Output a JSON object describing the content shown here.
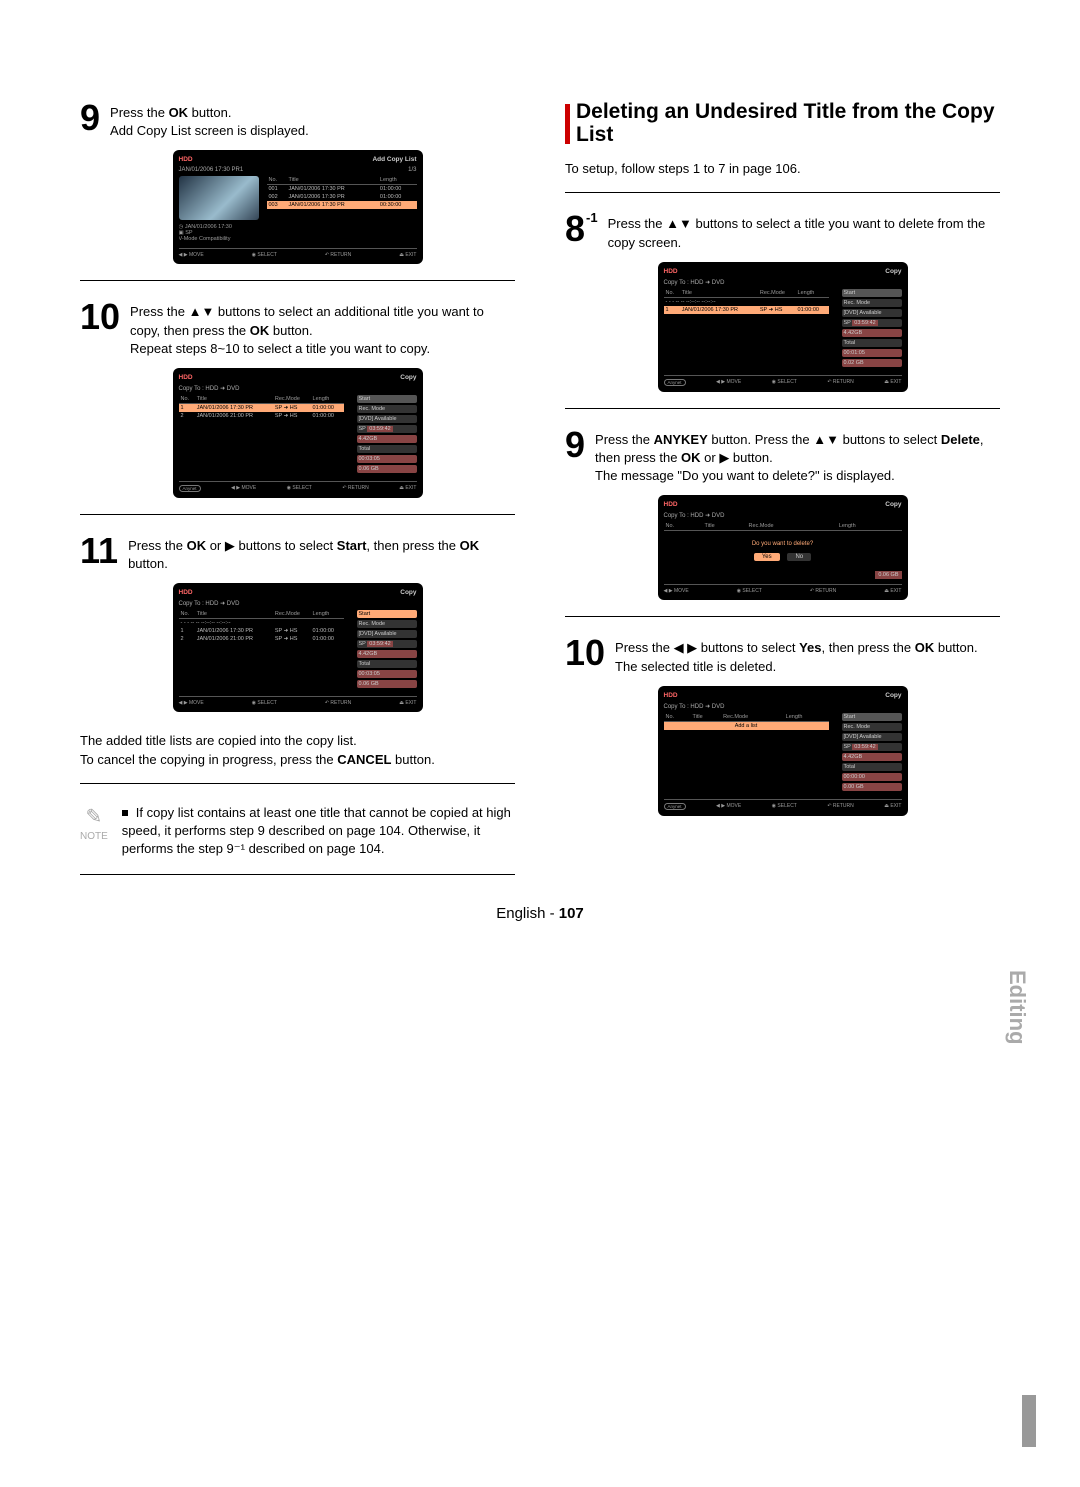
{
  "side_label": "Editing",
  "footer": {
    "lang": "English -",
    "page": "107"
  },
  "section": {
    "title": "Deleting an Undesired Title from the Copy List",
    "subtitle": "To setup, follow steps 1 to 7 in page 106."
  },
  "left": {
    "step9": {
      "num": "9",
      "l1a": "Press the ",
      "l1b": "OK",
      "l1c": " button.",
      "l2": "Add Copy List screen is displayed."
    },
    "step10": {
      "num": "10",
      "l1": "Press the ▲▼ buttons to select an additional title you want to copy, then press the ",
      "l1b": "OK",
      "l1c": " button.",
      "l2": "Repeat steps 8~10 to select a title you want to copy."
    },
    "step11": {
      "num": "11",
      "l1a": "Press the ",
      "l1b": "OK",
      "l1c": " or ▶ buttons to select ",
      "l1d": "Start",
      "l1e": ", then press the ",
      "l1f": "OK",
      "l1g": " button."
    },
    "post11": {
      "l1": "The added title lists are copied into the copy list.",
      "l2a": "To cancel the copying in progress, press the ",
      "l2b": "CANCEL",
      "l2c": " button."
    },
    "note": {
      "label": "NOTE",
      "text": "If copy list contains at least one title that cannot be copied at high speed, it performs step 9 described on page 104. Otherwise, it performs the step 9⁻¹ described on page 104."
    }
  },
  "right": {
    "step8": {
      "num": "8",
      "sup": "-1",
      "l1": "Press the ▲▼ buttons to select a title you want to delete from the copy screen."
    },
    "step9": {
      "num": "9",
      "l1a": "Press the ",
      "l1b": "ANYKEY",
      "l1c": " button. Press the ▲▼ buttons to select ",
      "l1d": "Delete",
      "l1e": ", then press the ",
      "l1f": "OK",
      "l1g": " or ▶ button.",
      "l2": "The message \"Do you want to delete?\" is displayed."
    },
    "step10": {
      "num": "10",
      "l1a": "Press the ◀ ▶ buttons to select ",
      "l1b": "Yes",
      "l1c": ", then press the ",
      "l1d": "OK",
      "l1e": " button.",
      "l2": "The selected title is deleted."
    }
  },
  "ui": {
    "hdd": "HDD",
    "addcopy_title": "Add Copy List",
    "copy_title": "Copy",
    "copyto": "Copy To : HDD ➜ DVD",
    "main_header": "JAN/01/2006 17:30 PR1",
    "main_counter": "1/3",
    "cols": {
      "no": "No.",
      "title": "Title",
      "rec": "Rec.Mode",
      "len": "Length"
    },
    "addlist_cols": {
      "no": "No.",
      "title": "Title",
      "len": "Length"
    },
    "addlist_rows": [
      {
        "no": "001",
        "title": "JAN/01/2006 17:30 PR",
        "len": "01:00:00"
      },
      {
        "no": "002",
        "title": "JAN/01/2006 17:30 PR",
        "len": "01:00:00"
      },
      {
        "no": "003",
        "title": "JAN/01/2006 17:30 PR",
        "hi": true,
        "len": "00:30:00"
      }
    ],
    "rows1": [
      {
        "no": "1",
        "title": "JAN/01/2006 17:30 PR",
        "rec": "SP ➜ HS",
        "len": "01:00:00",
        "hi": true
      },
      {
        "no": "2",
        "title": "JAN/01/2006 21:00 PR",
        "rec": "SP ➜ HS",
        "len": "01:00:00"
      }
    ],
    "rows2": [
      {
        "no": "1",
        "title": "JAN/01/2006 17:30 PR",
        "rec": "SP ➜ HS",
        "len": "01:00:00"
      },
      {
        "no": "2",
        "title": "JAN/01/2006 21:00 PR",
        "rec": "SP ➜ HS",
        "len": "01:00:00"
      }
    ],
    "rows_r1": [
      {
        "no": "1",
        "title": "JAN/01/2006 17:30 PR",
        "rec": "SP ➜ HS",
        "len": "01:00:00",
        "hi": true
      }
    ],
    "dashrow": "- - - -- -- --:--:-- --:--:--",
    "side": {
      "start": "Start",
      "recmode": "Rec. Mode",
      "avail": "[DVD] Available",
      "sp": "SP",
      "sp_t1": "03:59:42",
      "sp_gb1": "4.42GB",
      "total": "Total",
      "total_t_a": "00:03:05",
      "total_gb_a": "0.06 GB",
      "total_t_b": "00:03:05",
      "total_gb_b": "0.06 GB",
      "total_t_r1": "00:01:05",
      "total_gb_r1": "0.02 GB",
      "total_gb_r2": "0.06 GB",
      "total_t_r3": "00:00:00",
      "total_gb_r3": "0.00 GB"
    },
    "footer": {
      "any": "Anynet",
      "move": "◀ ▶ MOVE",
      "select": "◉ SELECT",
      "return": "↶ RETURN",
      "exit": "⏏ EXIT"
    },
    "leftinfo": {
      "l1": "JAN/01/2006 17:30",
      "l2": "SP",
      "l3": "V-Mode Compatibility"
    },
    "addlist": "Add a list",
    "prompt": {
      "msg": "Do you want to delete?",
      "yes": "Yes",
      "no": "No"
    }
  }
}
